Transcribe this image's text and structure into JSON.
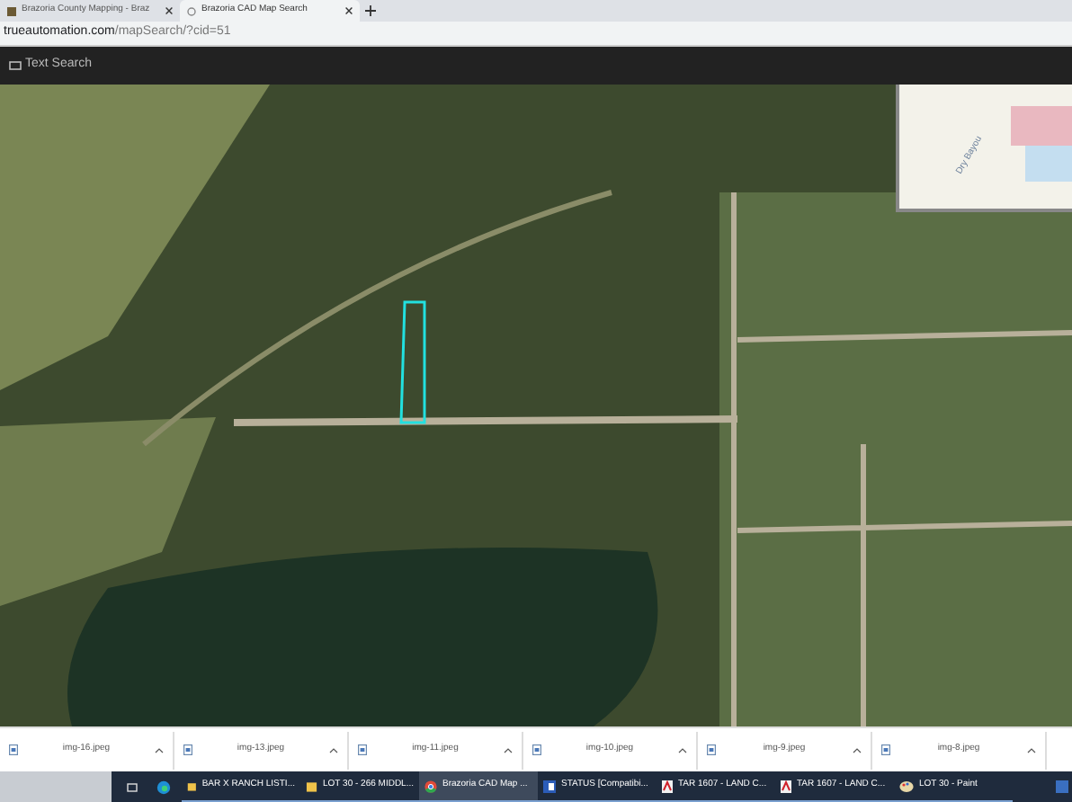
{
  "tabs": [
    {
      "title": "Brazoria County Mapping - Braz",
      "selected": false
    },
    {
      "title": "Brazoria CAD Map Search",
      "selected": true
    }
  ],
  "address": {
    "host": "trueautomation.com",
    "path": "/mapSearch/?cid=51"
  },
  "toolbar": {
    "button": "Text Search"
  },
  "overview_map": {
    "label": "Dry Bayou"
  },
  "downloads": [
    {
      "name": "img-16.jpeg"
    },
    {
      "name": "img-13.jpeg"
    },
    {
      "name": "img-11.jpeg"
    },
    {
      "name": "img-10.jpeg"
    },
    {
      "name": "img-9.jpeg"
    },
    {
      "name": "img-8.jpeg"
    }
  ],
  "taskbar": [
    {
      "kind": "folder",
      "label": "BAR X RANCH LISTI...",
      "selected": false
    },
    {
      "kind": "folder",
      "label": "LOT 30 - 266 MIDDL...",
      "selected": false
    },
    {
      "kind": "chrome",
      "label": "Brazoria CAD Map ...",
      "selected": true
    },
    {
      "kind": "word",
      "label": "STATUS [Compatibi...",
      "selected": false
    },
    {
      "kind": "pdf",
      "label": "TAR 1607 - LAND C...",
      "selected": false
    },
    {
      "kind": "pdf",
      "label": "TAR 1607 - LAND C...",
      "selected": false
    },
    {
      "kind": "paint",
      "label": "LOT 30 - Paint",
      "selected": false
    }
  ]
}
